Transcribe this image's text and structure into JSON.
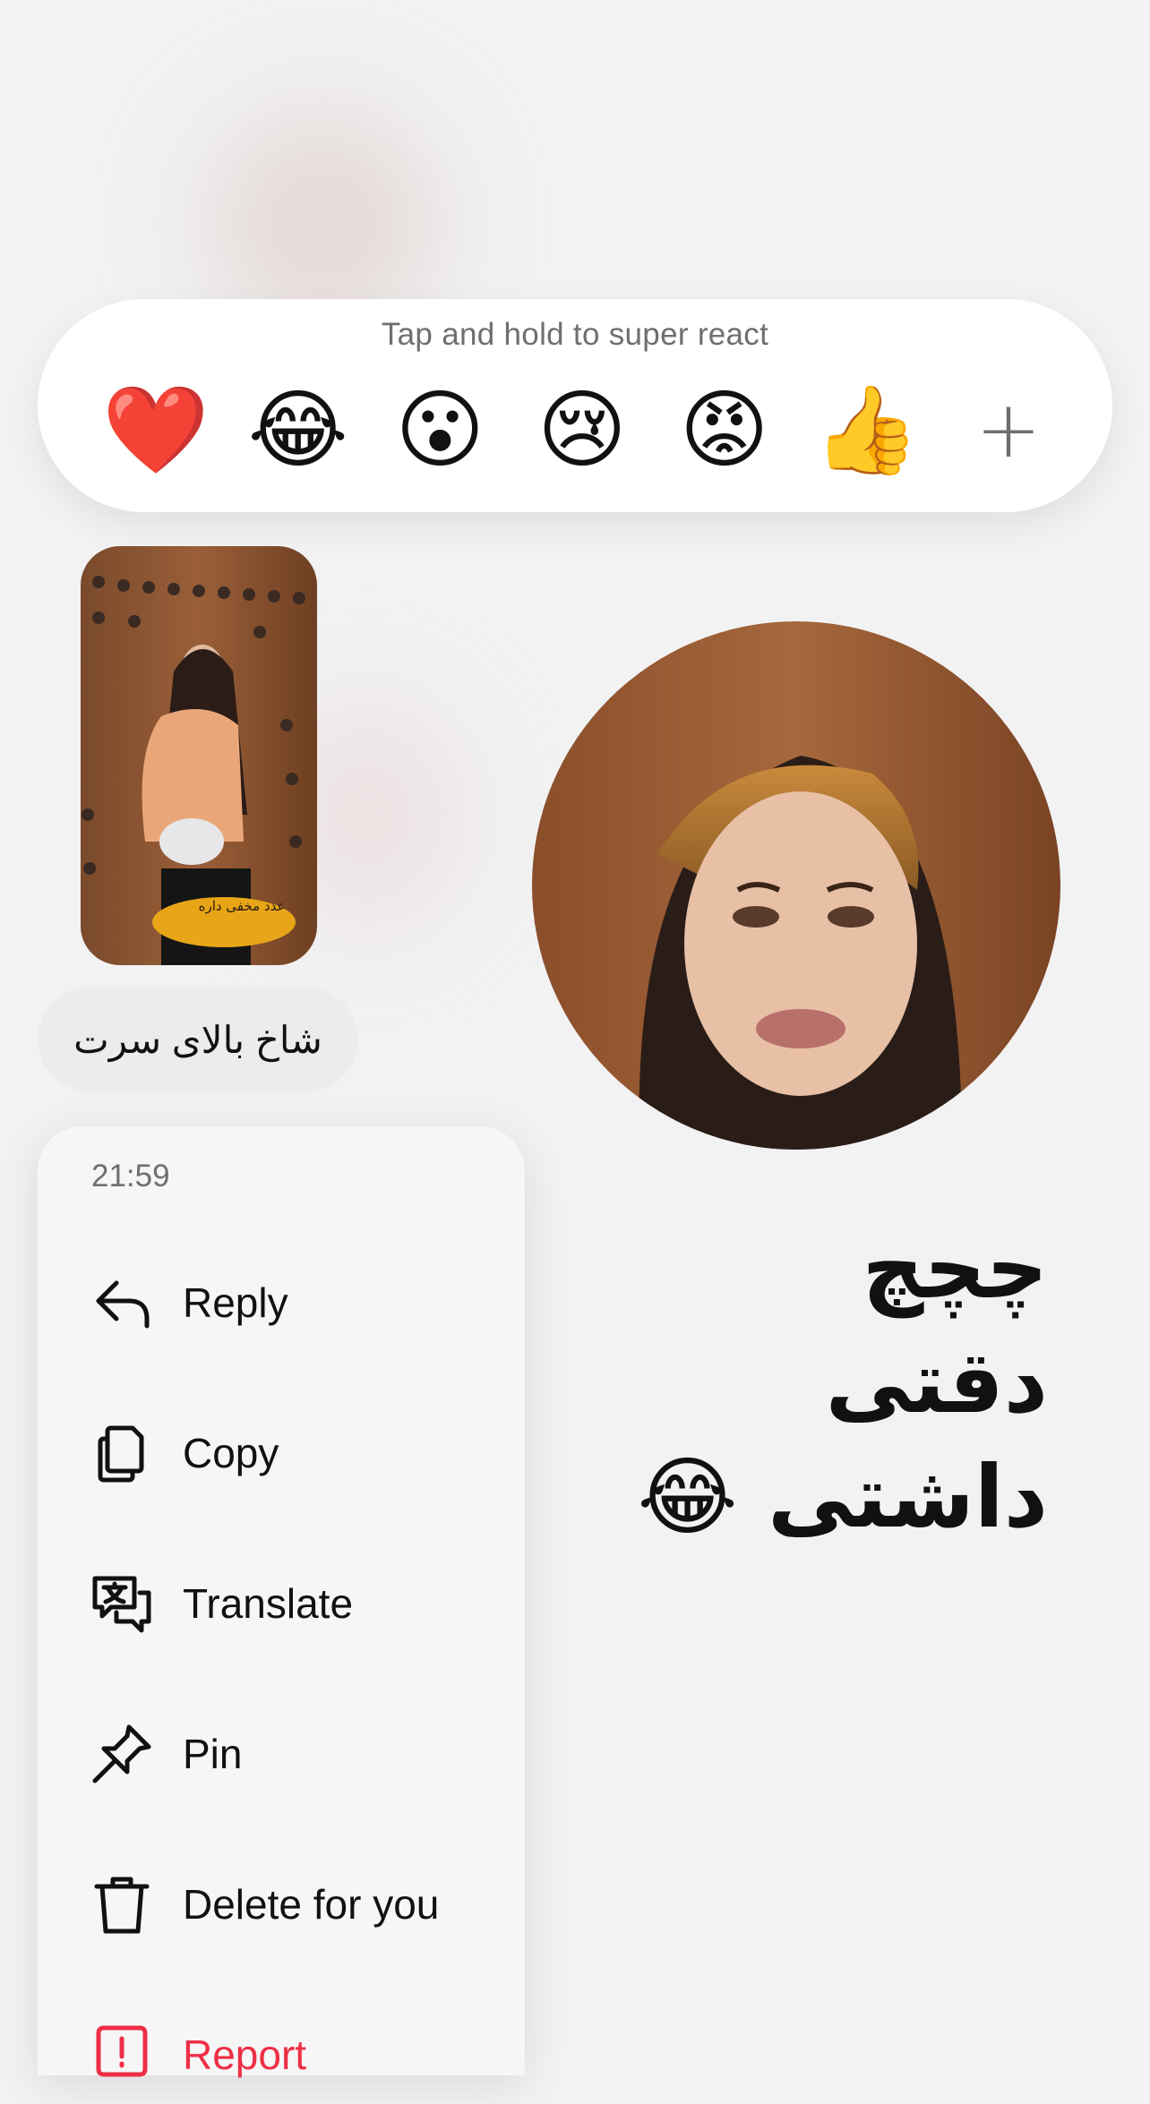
{
  "reaction_bar": {
    "hint": "Tap and hold to super react",
    "reactions": [
      "❤️",
      "😂",
      "😮",
      "😢",
      "😡",
      "👍"
    ],
    "more_icon": "plus-icon",
    "more_label": "+"
  },
  "story_reply": {
    "sticker_text": "عدد مخفی داره",
    "message": "شاخ بالای سرت"
  },
  "sticker_message": {
    "text_line1": "چچچ دقتی",
    "text_line2": "داشتی 😂"
  },
  "context_menu": {
    "time": "21:59",
    "items": [
      {
        "label": "Reply",
        "icon": "reply-arrow-icon"
      },
      {
        "label": "Copy",
        "icon": "copy-icon"
      },
      {
        "label": "Translate",
        "icon": "translate-icon"
      },
      {
        "label": "Pin",
        "icon": "pin-icon"
      },
      {
        "label": "Delete for you",
        "icon": "trash-icon"
      },
      {
        "label": "Report",
        "icon": "report-icon"
      }
    ]
  },
  "colors": {
    "background": "#f2f2f3",
    "danger": "#ed2f45",
    "secondary_text": "#6e6e73"
  }
}
